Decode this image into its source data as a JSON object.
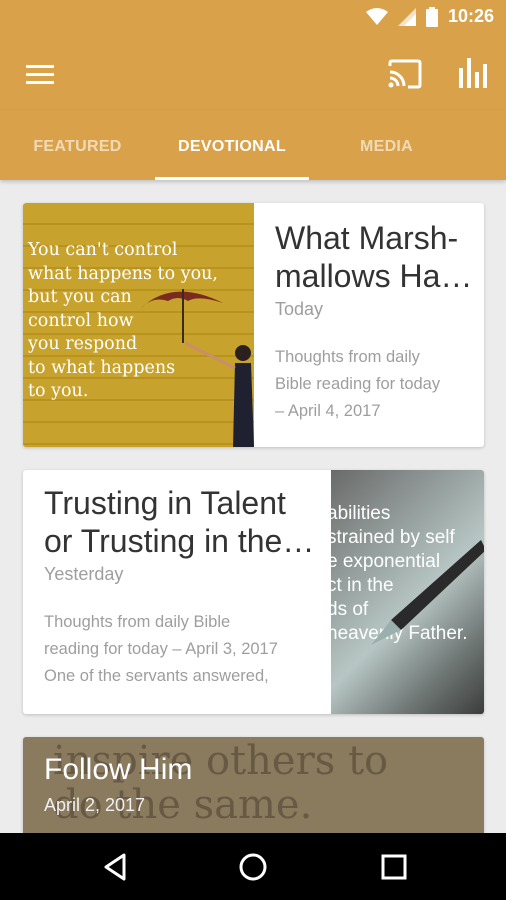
{
  "status_bar": {
    "time": "10:26"
  },
  "app_bar": {
    "icons": [
      "menu-icon",
      "cast-icon",
      "bar-chart-icon"
    ]
  },
  "tabs": [
    {
      "label": "FEATURED",
      "active": false
    },
    {
      "label": "DEVOTIONAL",
      "active": true
    },
    {
      "label": "MEDIA",
      "active": false
    }
  ],
  "cards": [
    {
      "title": "What Marsh-mallows Ha…",
      "title_line1": "What Marsh-",
      "title_line2": "mallows Ha…",
      "date": "Today",
      "excerpt_line1": "Thoughts from daily",
      "excerpt_line2": "Bible reading for today",
      "excerpt_line3": "– April 4, 2017",
      "image_quote": [
        "You can't control",
        "what happens to you,",
        "but you can",
        "control how",
        "you respond",
        "to what happens",
        "to you."
      ]
    },
    {
      "title_line1": "Trusting in Talent",
      "title_line2": "or Trusting in the…",
      "date": "Yesterday",
      "excerpt_line1": "Thoughts from daily Bible",
      "excerpt_line2": "reading for today – April 3, 2017",
      "excerpt_line3": "One of the servants answered,",
      "image_quote": [
        "abilities",
        "strained by self",
        "e exponential",
        "ct in the",
        "ds of",
        "heavenly Father."
      ]
    },
    {
      "title": "Follow Him",
      "date": "April 2, 2017",
      "image_quote": [
        "inspire others to",
        "do the same."
      ]
    }
  ],
  "colors": {
    "primary": "#d9a24a",
    "background": "#ececec"
  }
}
